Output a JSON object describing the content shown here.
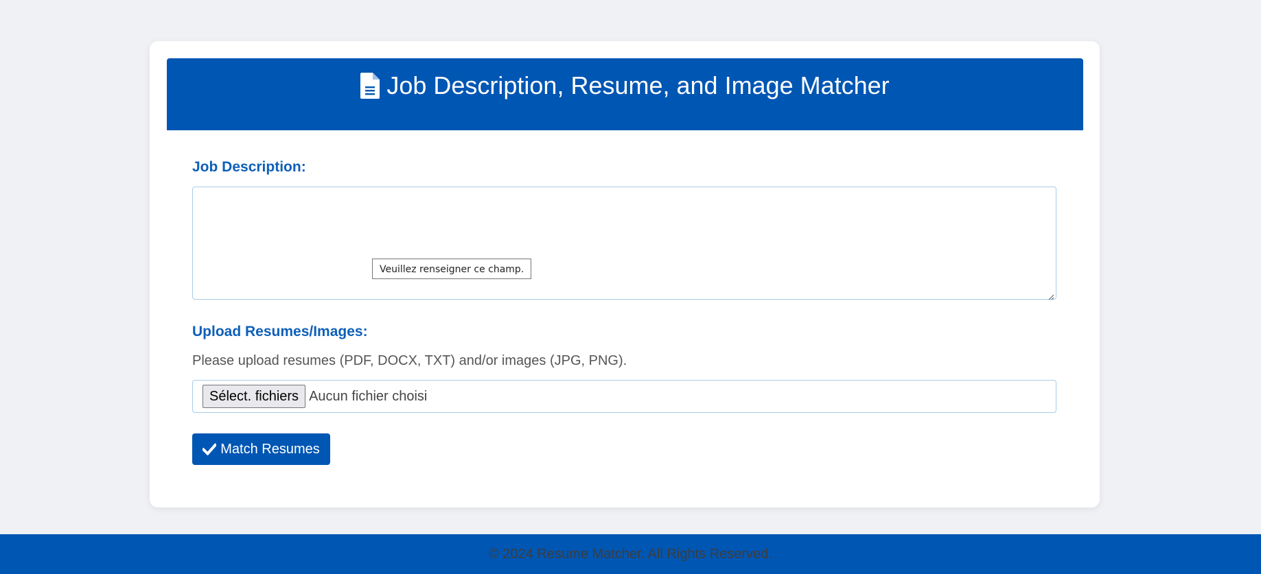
{
  "header": {
    "title": "Job Description, Resume, and Image Matcher",
    "icon": "file-document-icon"
  },
  "job_description": {
    "label": "Job Description:",
    "value": "",
    "validation_tooltip": "Veuillez renseigner ce champ."
  },
  "upload": {
    "label": "Upload Resumes/Images:",
    "hint": "Please upload resumes (PDF, DOCX, TXT) and/or images (JPG, PNG).",
    "button_label": "Sélect. fichiers",
    "status": "Aucun fichier choisi"
  },
  "submit": {
    "label": "Match Resumes",
    "icon": "check-icon"
  },
  "footer": {
    "text": "© 2024 Resume Matcher. All Rights Reserved."
  },
  "colors": {
    "brand": "#0056b3",
    "label": "#0d5fb8",
    "background": "#eff1f5"
  }
}
